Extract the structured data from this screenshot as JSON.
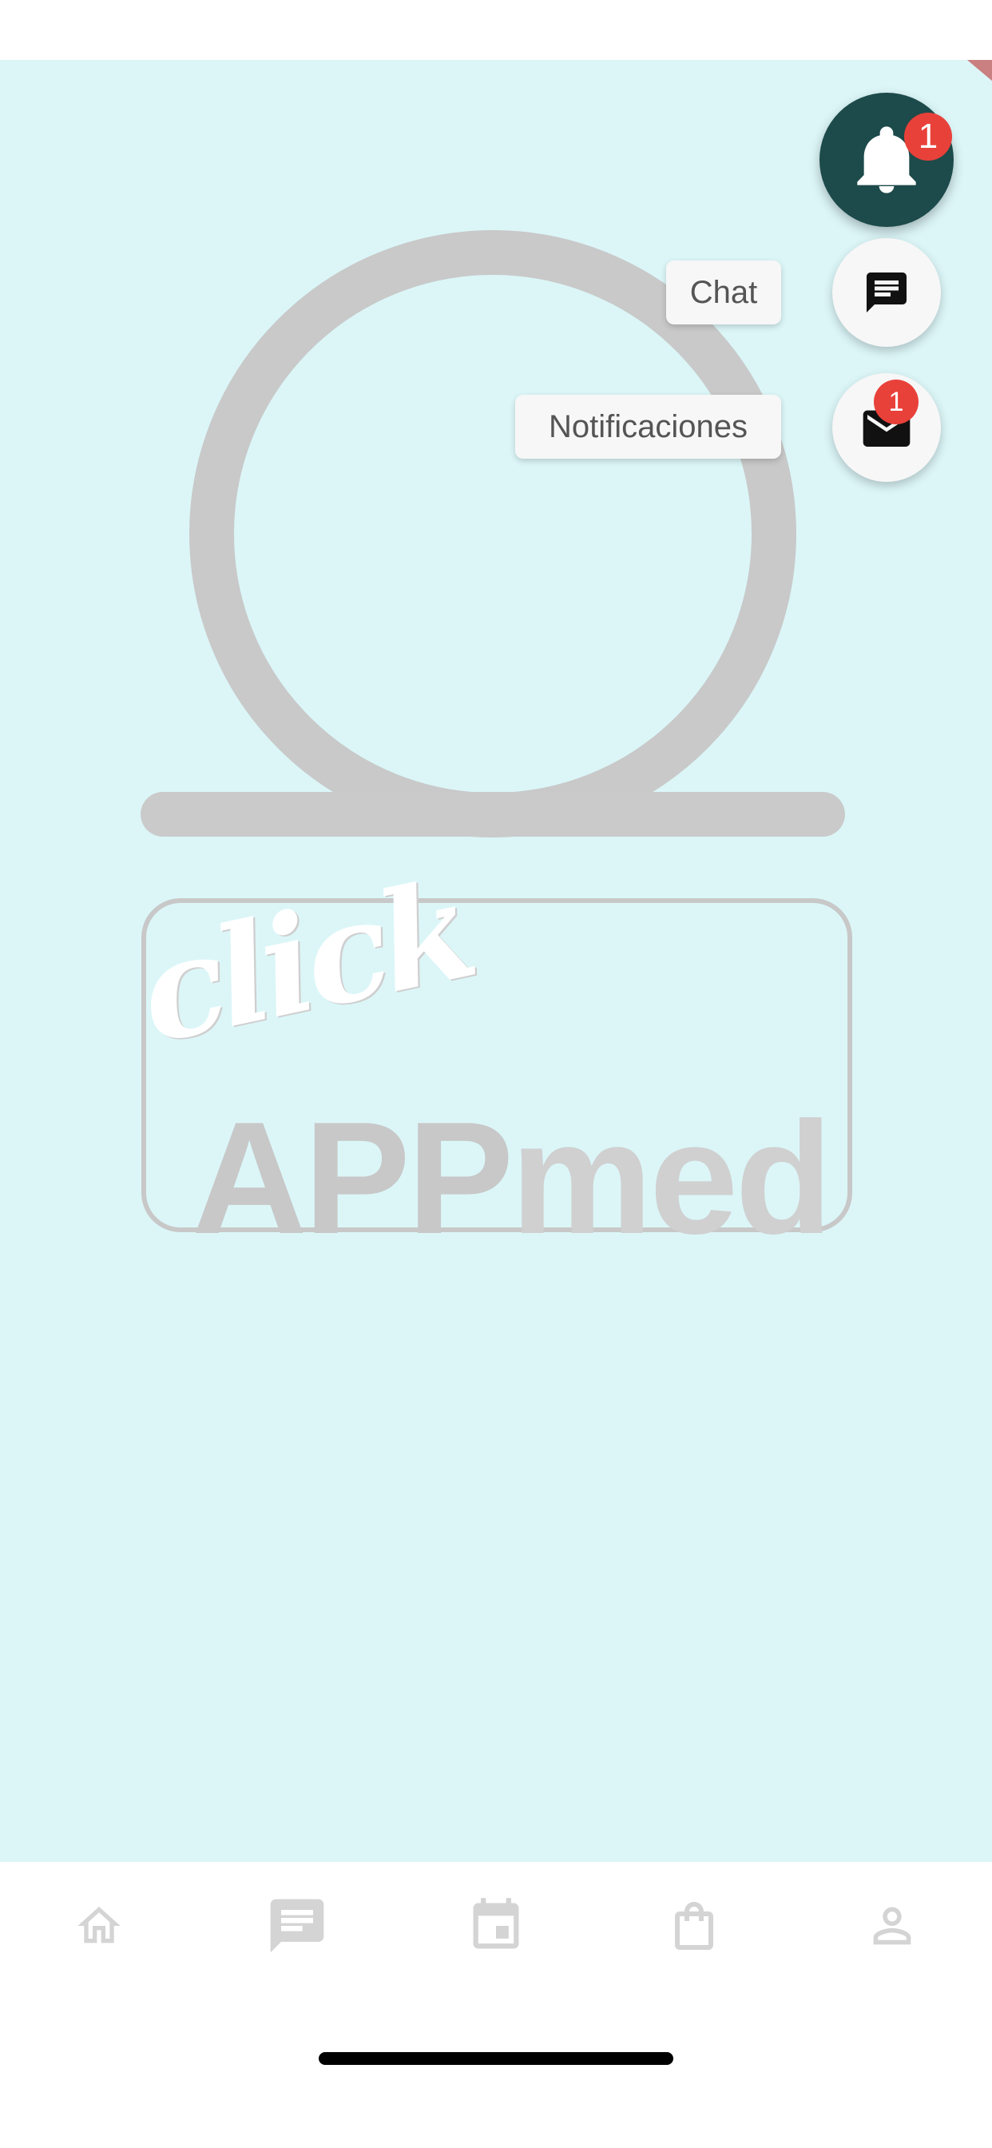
{
  "app": {
    "background_color": "#dcf6f8",
    "accent": "#1d4a4a",
    "badge_color": "#e8413a"
  },
  "logo": {
    "script_text": "click",
    "word_part1": "APP",
    "word_part2": "med"
  },
  "fab": {
    "main_icon": "bell-icon",
    "main_badge": "1",
    "actions": [
      {
        "label": "Chat",
        "icon": "chat-icon"
      },
      {
        "label": "Notificaciones",
        "icon": "mail-icon",
        "badge": "1"
      }
    ]
  },
  "tabs": [
    {
      "icon": "home-icon"
    },
    {
      "icon": "chat-icon"
    },
    {
      "icon": "calendar-icon"
    },
    {
      "icon": "shopping-bag-icon"
    },
    {
      "icon": "profile-icon"
    }
  ]
}
